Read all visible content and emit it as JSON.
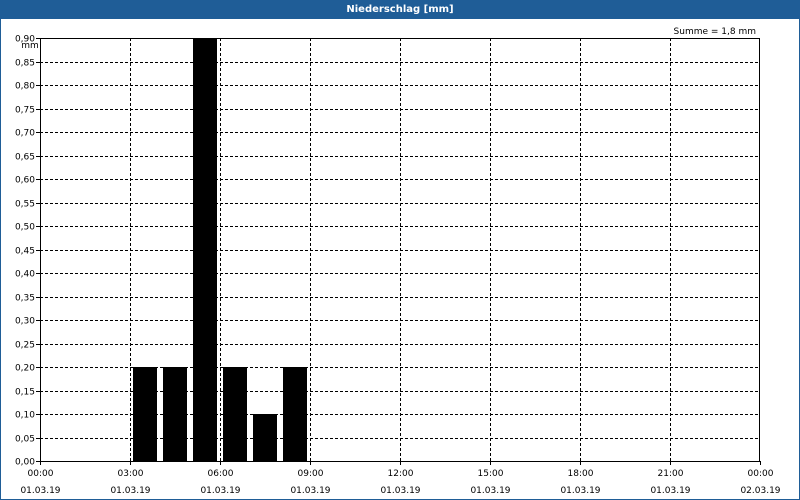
{
  "title": "Niederschlag [mm]",
  "sum_label": "Summe = 1,8 mm",
  "colors": {
    "title_bar": "#1f5d97",
    "bars": "#000000",
    "grid": "#000000",
    "background": "#ffffff"
  },
  "chart_data": {
    "type": "bar",
    "title": "Niederschlag [mm]",
    "ylabel": "mm",
    "xlabel": "",
    "ylim": [
      0,
      0.9
    ],
    "xlim": [
      "01.03.19 00:00",
      "02.03.19 00:00"
    ],
    "grid": true,
    "y_ticks": [
      "0,00",
      "0,05",
      "0,10",
      "0,15",
      "0,20",
      "0,25",
      "0,30",
      "0,35",
      "0,40",
      "0,45",
      "0,50",
      "0,55",
      "0,60",
      "0,65",
      "0,70",
      "0,75",
      "0,80",
      "0,85",
      "0,90"
    ],
    "x_ticks": [
      {
        "time": "00:00",
        "date": "01.03.19"
      },
      {
        "time": "03:00",
        "date": "01.03.19"
      },
      {
        "time": "06:00",
        "date": "01.03.19"
      },
      {
        "time": "09:00",
        "date": "01.03.19"
      },
      {
        "time": "12:00",
        "date": "01.03.19"
      },
      {
        "time": "15:00",
        "date": "01.03.19"
      },
      {
        "time": "18:00",
        "date": "01.03.19"
      },
      {
        "time": "21:00",
        "date": "01.03.19"
      },
      {
        "time": "00:00",
        "date": "02.03.19"
      }
    ],
    "bars": [
      {
        "start": "01.03.19 03:00",
        "end": "01.03.19 04:00",
        "value": 0.2
      },
      {
        "start": "01.03.19 04:00",
        "end": "01.03.19 05:00",
        "value": 0.2
      },
      {
        "start": "01.03.19 05:00",
        "end": "01.03.19 06:00",
        "value": 0.9
      },
      {
        "start": "01.03.19 06:00",
        "end": "01.03.19 07:00",
        "value": 0.2
      },
      {
        "start": "01.03.19 07:00",
        "end": "01.03.19 08:00",
        "value": 0.1
      },
      {
        "start": "01.03.19 08:00",
        "end": "01.03.19 09:00",
        "value": 0.2
      }
    ]
  }
}
